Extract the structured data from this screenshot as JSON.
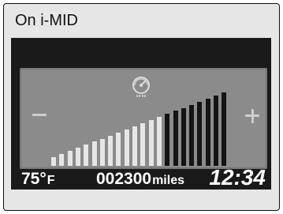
{
  "caption": "On i-MID",
  "gauge": {
    "minus_symbol": "−",
    "plus_symbol": "+",
    "icon": "eco-speedometer-icon",
    "bars_total": 22,
    "bars_lit": 14,
    "colors": {
      "lit": "#e6e6e6",
      "unlit": "#141414",
      "panel": "#8b8b8b",
      "border": "#777777"
    }
  },
  "status": {
    "temperature_value": "75°",
    "temperature_unit": "F",
    "odometer_value": "002300",
    "odometer_unit": "miles",
    "clock": "12:34"
  },
  "colors": {
    "screen_bg": "#1a1a1a",
    "caption_bg": "#e6e6e6",
    "text": "#ffffff"
  }
}
